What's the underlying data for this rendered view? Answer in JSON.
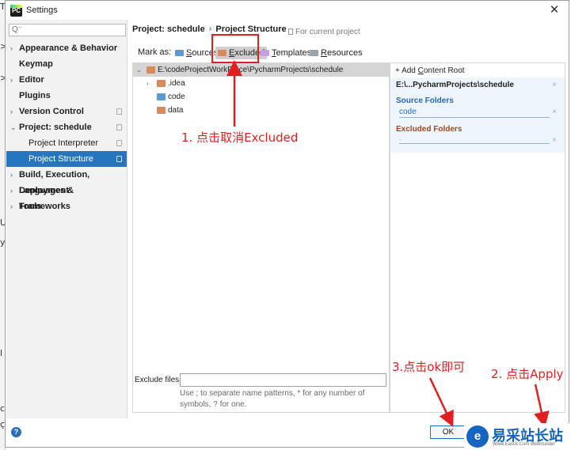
{
  "window": {
    "title": "Settings",
    "app_icon_text": "PC",
    "close_glyph": "✕"
  },
  "background_window": {
    "edge_chars": [
      "T",
      ">",
      ">",
      "U",
      "y",
      "l",
      "c",
      "ç"
    ]
  },
  "sidebar": {
    "search_placeholder": "",
    "search_icon": "search-icon",
    "items": [
      {
        "label": "Appearance & Behavior",
        "arrow": "›",
        "level": 0,
        "copy": false,
        "selected": false
      },
      {
        "label": "Keymap",
        "arrow": "",
        "level": 0,
        "copy": false,
        "selected": false
      },
      {
        "label": "Editor",
        "arrow": "›",
        "level": 0,
        "copy": false,
        "selected": false
      },
      {
        "label": "Plugins",
        "arrow": "",
        "level": 0,
        "copy": false,
        "selected": false
      },
      {
        "label": "Version Control",
        "arrow": "›",
        "level": 0,
        "copy": true,
        "selected": false
      },
      {
        "label": "Project: schedule",
        "arrow": "⌄",
        "level": 0,
        "copy": true,
        "selected": false
      },
      {
        "label": "Project Interpreter",
        "arrow": "",
        "level": 1,
        "copy": true,
        "selected": false
      },
      {
        "label": "Project Structure",
        "arrow": "",
        "level": 1,
        "copy": true,
        "selected": true
      },
      {
        "label": "Build, Execution, Deployment",
        "arrow": "›",
        "level": 0,
        "copy": false,
        "selected": false
      },
      {
        "label": "Languages & Frameworks",
        "arrow": "›",
        "level": 0,
        "copy": false,
        "selected": false
      },
      {
        "label": "Tools",
        "arrow": "›",
        "level": 0,
        "copy": false,
        "selected": false
      }
    ]
  },
  "header": {
    "breadcrumb_project": "Project: schedule",
    "breadcrumb_sep": "›",
    "breadcrumb_page": "Project Structure",
    "for_current_project": "For current project"
  },
  "mark_as": {
    "label": "Mark as:",
    "buttons": [
      {
        "first": "S",
        "rest": "ources",
        "color": "#5b9bd5"
      },
      {
        "first": "E",
        "rest": "xcluded",
        "color": "#d98a5a"
      },
      {
        "first": "T",
        "rest": "emplates",
        "color": "#c59ee6"
      },
      {
        "first": "R",
        "rest": "esources",
        "color": "#9aa4ad"
      }
    ]
  },
  "folder_tree": {
    "root": "E:\\codeProjectWorkPlace\\PycharmProjects\\schedule",
    "children": [
      {
        "name": ".idea",
        "arrow": "›",
        "color": "#d98a5a"
      },
      {
        "name": "code",
        "arrow": "",
        "color": "#5b9bd5"
      },
      {
        "name": "data",
        "arrow": "",
        "color": "#d98a5a"
      }
    ],
    "root_arrow": "⌄",
    "root_color": "#d98a5a"
  },
  "exclude_files": {
    "label": "Exclude files:",
    "value": "",
    "hint": "Use ; to separate name patterns, * for any number of symbols, ? for one."
  },
  "content_roots": {
    "add_label_plus": "+ Add ",
    "add_label_underlined": "C",
    "add_label_rest": "ontent Root",
    "root_path": "E:\\...PycharmProjects\\schedule",
    "source_folders_title": "Source Folders",
    "source_folders": [
      "code"
    ],
    "excluded_folders_title": "Excluded Folders",
    "excluded_folders_placeholder": ".",
    "remove_glyph": "×"
  },
  "footer": {
    "help_glyph": "?",
    "ok_label": "OK"
  },
  "annotations": {
    "step1": "1. 点击取消Excluded",
    "step2": "2. 点击Apply",
    "step3": "3.点击ok即可",
    "color": "#e02020"
  },
  "watermark": {
    "logo_glyph": "e",
    "text": "易采站长站",
    "sub": "Www.Easck.Com Webmaster"
  }
}
